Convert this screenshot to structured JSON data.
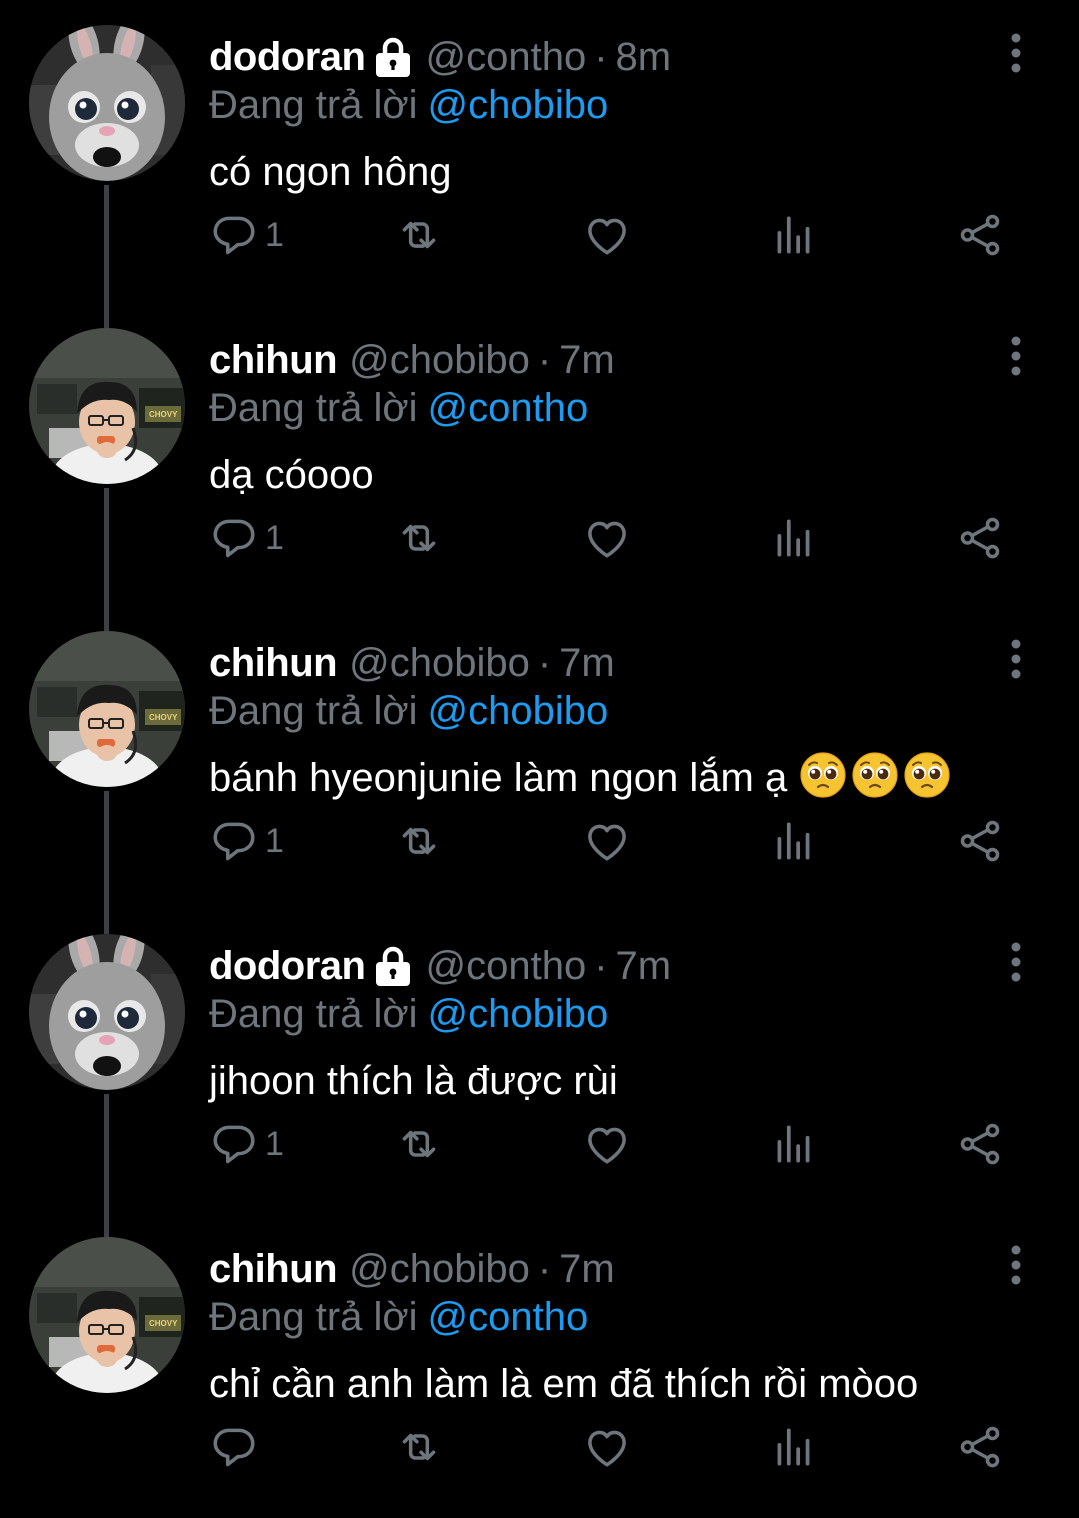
{
  "colors": {
    "background": "#000000",
    "name": "#ffffff",
    "secondary_text": "#6e767d",
    "link": "#1d9bf0",
    "thread_line": "#3a4046"
  },
  "tweets": [
    {
      "name": "dodoran",
      "protected": true,
      "handle": "@contho",
      "separator": "·",
      "time": "8m",
      "reply_prefix": "Đang trả lời",
      "reply_to": "@chobibo",
      "text": "có ngon hông",
      "emoji": [],
      "reply_count": "1",
      "avatar": "bunny-mascot"
    },
    {
      "name": "chihun",
      "protected": false,
      "handle": "@chobibo",
      "separator": "·",
      "time": "7m",
      "reply_prefix": "Đang trả lời",
      "reply_to": "@contho",
      "text": "dạ cóooo",
      "emoji": [],
      "reply_count": "1",
      "avatar": "boy-eating"
    },
    {
      "name": "chihun",
      "protected": false,
      "handle": "@chobibo",
      "separator": "·",
      "time": "7m",
      "reply_prefix": "Đang trả lời",
      "reply_to": "@chobibo",
      "text": "bánh hyeonjunie làm ngon lắm ạ",
      "emoji": [
        "pleading-face",
        "pleading-face",
        "pleading-face"
      ],
      "reply_count": "1",
      "avatar": "boy-eating"
    },
    {
      "name": "dodoran",
      "protected": true,
      "handle": "@contho",
      "separator": "·",
      "time": "7m",
      "reply_prefix": "Đang trả lời",
      "reply_to": "@chobibo",
      "text": "jihoon thích là được rùi",
      "emoji": [],
      "reply_count": "1",
      "avatar": "bunny-mascot"
    },
    {
      "name": "chihun",
      "protected": false,
      "handle": "@chobibo",
      "separator": "·",
      "time": "7m",
      "reply_prefix": "Đang trả lời",
      "reply_to": "@contho",
      "text": "chỉ cần anh làm là em đã thích rồi mòoo",
      "emoji": [],
      "reply_count": "",
      "avatar": "boy-eating"
    }
  ]
}
